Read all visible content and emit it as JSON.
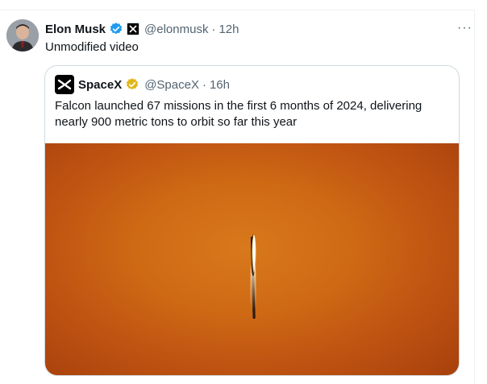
{
  "tweet": {
    "author_name": "Elon Musk",
    "handle": "@elonmusk",
    "separator": "·",
    "time": "12h",
    "text": "Unmodified video",
    "more_label": "···"
  },
  "quoted": {
    "author_name": "SpaceX",
    "handle": "@SpaceX",
    "separator": "·",
    "time": "16h",
    "text": "Falcon launched 67 missions in the first 6 months of 2024, delivering nearly 900 metric tons to orbit so far this year"
  },
  "colors": {
    "verified_blue": "#1d9bf0",
    "verified_gold": "#e2b719",
    "media_orange": "#cf6a14"
  },
  "icons": [
    "verified-badge-icon",
    "x-affiliate-badge-icon",
    "more-icon",
    "spacex-logo-icon",
    "gold-verified-badge-icon"
  ]
}
